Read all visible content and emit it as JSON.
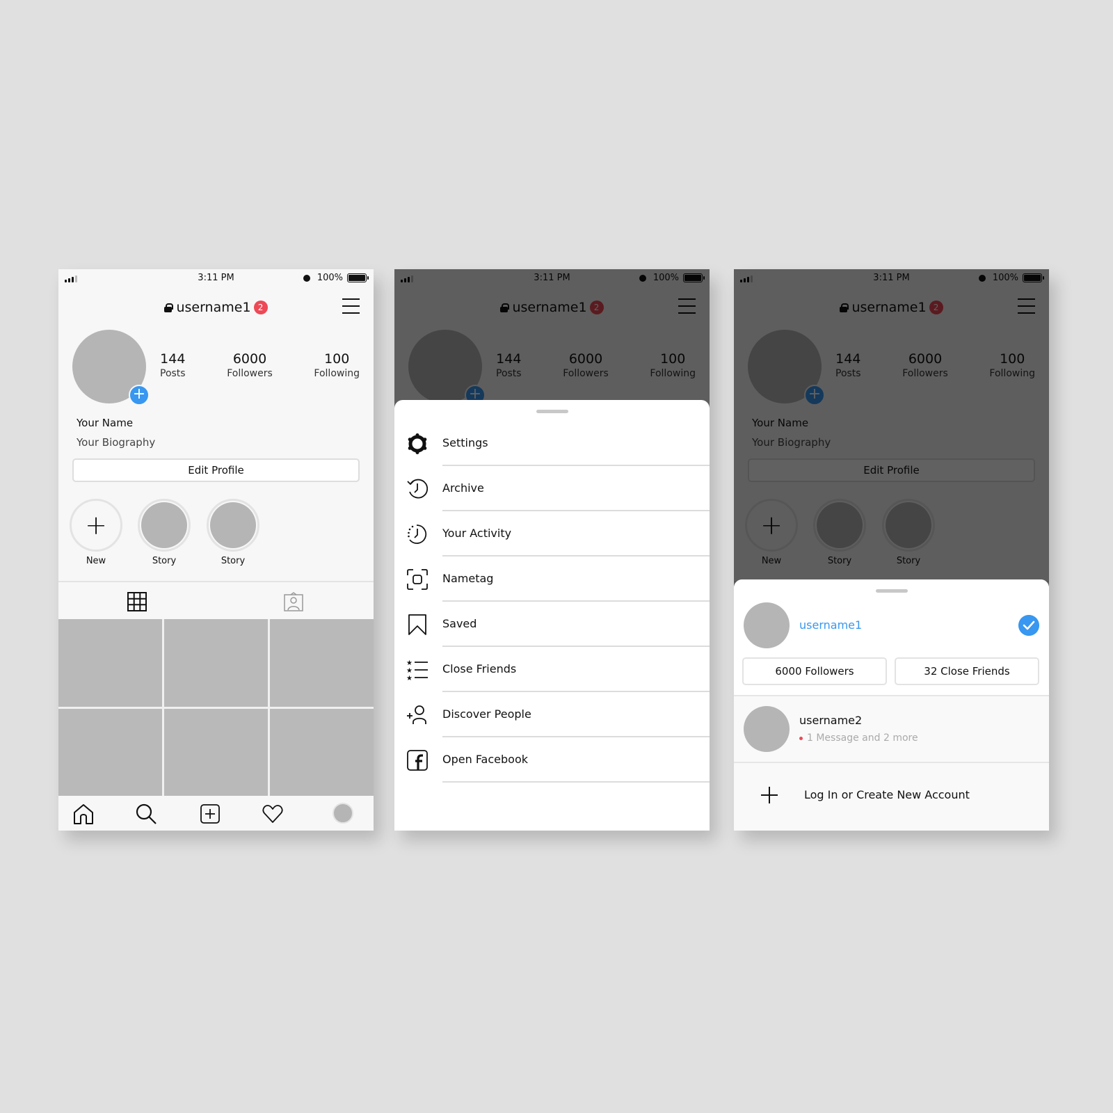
{
  "status_bar": {
    "time": "3:11 PM",
    "battery": "100%"
  },
  "profile": {
    "username": "username1",
    "notification_count": "2",
    "name": "Your Name",
    "bio": "Your Biography",
    "edit_button": "Edit Profile",
    "stats": [
      {
        "value": "144",
        "label": "Posts"
      },
      {
        "value": "6000",
        "label": "Followers"
      },
      {
        "value": "100",
        "label": "Following"
      }
    ],
    "highlights": [
      {
        "label": "New"
      },
      {
        "label": "Story"
      },
      {
        "label": "Story"
      }
    ],
    "grid_posts": 6
  },
  "bottom_nav": [
    "home-icon",
    "search-icon",
    "add-post-icon",
    "activity-heart-icon",
    "profile-avatar"
  ],
  "menu_sheet": {
    "items": [
      {
        "label": "Settings",
        "icon": "gear-icon"
      },
      {
        "label": "Archive",
        "icon": "archive-clock-icon"
      },
      {
        "label": "Your Activity",
        "icon": "activity-clock-icon"
      },
      {
        "label": "Nametag",
        "icon": "nametag-scan-icon"
      },
      {
        "label": "Saved",
        "icon": "bookmark-icon"
      },
      {
        "label": "Close Friends",
        "icon": "star-list-icon"
      },
      {
        "label": "Discover People",
        "icon": "add-person-icon"
      },
      {
        "label": "Open Facebook",
        "icon": "facebook-icon"
      }
    ]
  },
  "account_sheet": {
    "current_account": {
      "username": "username1"
    },
    "followers_button": "6000 Followers",
    "close_friends_button": "32 Close Friends",
    "other_account": {
      "username": "username2",
      "subtitle": "1 Message and 2 more"
    },
    "login_label": "Log In or Create New Account"
  },
  "colors": {
    "accent": "#3897f0",
    "badge": "#ed4956",
    "placeholder": "#b5b5b5",
    "background": "#e0e0e0"
  }
}
